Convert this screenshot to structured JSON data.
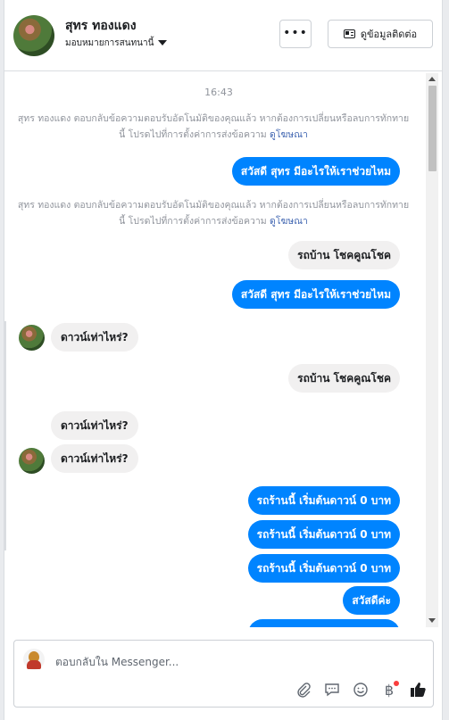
{
  "header": {
    "name": "สุทร ทองแดง",
    "assign_label": "มอบหมายการสนทนานี้",
    "more_label": "•••",
    "contact_label": "ดูข้อมูลติดต่อ"
  },
  "conversation": {
    "timestamp": "16:43",
    "notice_1": "สุทร ทองแดง ตอบกลับข้อความตอบรับอัตโนมัติของคุณแล้ว หากต้องการเปลี่ยนหรือลบการทักทายนี้ โปรดไปที่การตั้งค่าการส่งข้อความ",
    "notice_2": "สุทร ทองแดง ตอบกลับข้อความตอบรับอัตโนมัติของคุณแล้ว หากต้องการเปลี่ยนหรือลบการทักทายนี้ โปรดไปที่การตั้งค่าการส่งข้อความ",
    "notice_link": "ดูโฆษณา",
    "messages": {
      "m1": "สวัสดี สุทร มีอะไรให้เราช่วยไหม",
      "m2": "รถบ้าน โชคคูณโชค",
      "m3": "สวัสดี สุทร มีอะไรให้เราช่วยไหม",
      "m4": "ดาวน์เท่าไหร่?",
      "m5": "รถบ้าน โชคคูณโชค",
      "m6": "ดาวน์เท่าไหร่?",
      "m7": "ดาวน์เท่าไหร่?",
      "m8": "รถร้านนี้ เริ่มต้นดาวน์ 0 บาท",
      "m9": "รถร้านนี้ เริ่มต้นดาวน์ 0 บาท",
      "m10": "รถร้านนี้ เริ่มต้นดาวน์ 0 บาท",
      "m11": "สวัสดีค่ะ"
    }
  },
  "composer": {
    "placeholder": "ตอบกลับใน Messenger..."
  },
  "colors": {
    "outgoing_bubble": "#0084ff",
    "incoming_bubble": "#f1f0f0",
    "link": "#4267b2",
    "like": "#1c1e21",
    "badge": "#fa3e3e"
  }
}
